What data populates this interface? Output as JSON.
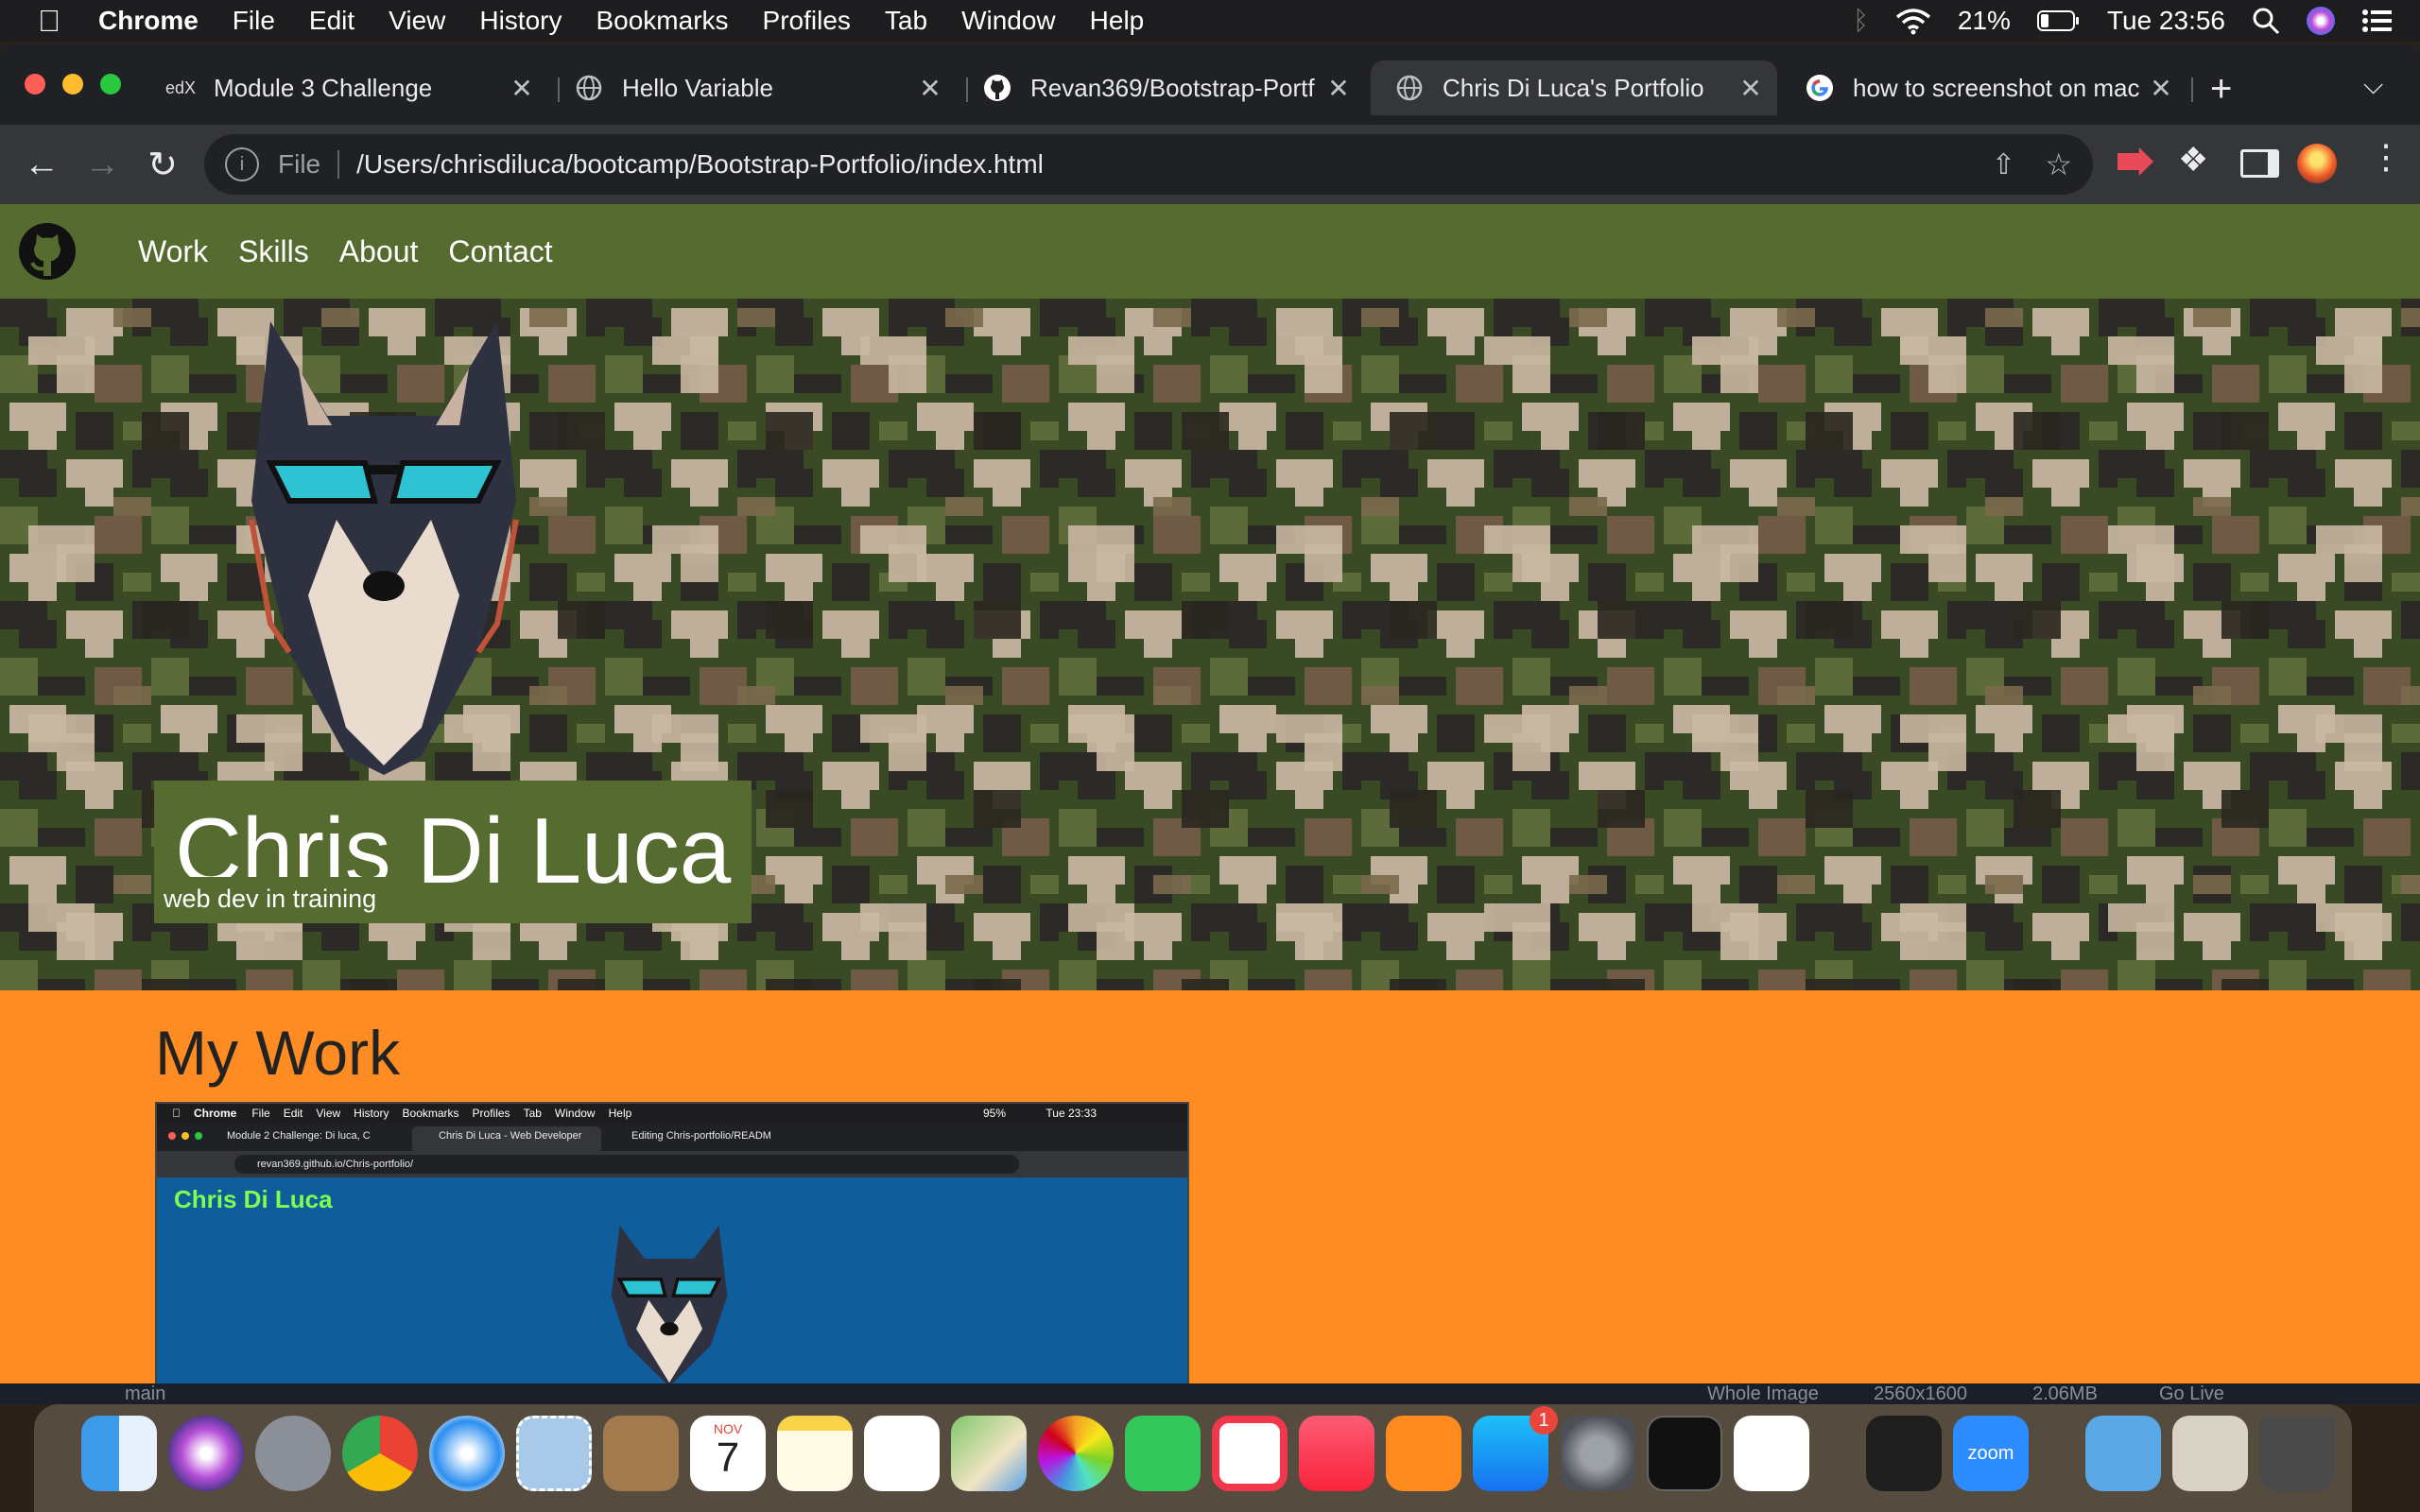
{
  "menubar": {
    "app": "Chrome",
    "items": [
      "File",
      "Edit",
      "View",
      "History",
      "Bookmarks",
      "Profiles",
      "Tab",
      "Window",
      "Help"
    ],
    "battery": "21%",
    "clock": "Tue 23:56"
  },
  "tabs": [
    {
      "title": "Module 3 Challenge",
      "icon": "edx-icon"
    },
    {
      "title": "Hello Variable",
      "icon": "globe-icon"
    },
    {
      "title": "Revan369/Bootstrap-Portf",
      "icon": "github-icon"
    },
    {
      "title": "Chris Di Luca's Portfolio",
      "icon": "globe-icon",
      "active": true
    },
    {
      "title": "how to screenshot on mac",
      "icon": "google-icon"
    }
  ],
  "address": {
    "scheme": "File",
    "url": "/Users/chrisdiluca/bootcamp/Bootstrap-Portfolio/index.html"
  },
  "site": {
    "nav": [
      "Work",
      "Skills",
      "About",
      "Contact"
    ],
    "name": "Chris Di Luca",
    "tagline": "web dev in training",
    "work_heading": "My Work"
  },
  "thumbnail": {
    "menu": [
      "Chrome",
      "File",
      "Edit",
      "View",
      "History",
      "Bookmarks",
      "Profiles",
      "Tab",
      "Window",
      "Help"
    ],
    "status": "95%",
    "clock": "Tue 23:33",
    "tabs": [
      "Module 2 Challenge: Di luca, C",
      "Chris Di Luca - Web Developer",
      "Editing Chris-portfolio/READM"
    ],
    "url": "revan369.github.io/Chris-portfolio/",
    "site_name": "Chris Di Luca"
  },
  "dock": {
    "calendar_month": "NOV",
    "calendar_day": "7",
    "appstore_badge": "1",
    "zoom_label": "zoom"
  },
  "vscode_status": {
    "branch": "main",
    "status": "Whole Image",
    "dims": "2560x1600",
    "size": "2.06MB",
    "live": "Go Live"
  },
  "colors": {
    "olive": "#556b2f",
    "orange": "#ff8c23",
    "chrome_dark": "#202124"
  }
}
